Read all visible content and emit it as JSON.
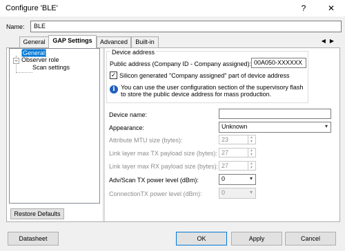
{
  "window": {
    "title": "Configure 'BLE'",
    "help_glyph": "?",
    "close_glyph": "✕"
  },
  "name_field": {
    "label": "Name:",
    "value": "BLE"
  },
  "tabs": [
    {
      "label": "General",
      "active": false
    },
    {
      "label": "GAP Settings",
      "active": true
    },
    {
      "label": "Advanced",
      "active": false
    },
    {
      "label": "Built-in",
      "active": false
    }
  ],
  "tab_scroll": {
    "left": "◀",
    "right": "▶"
  },
  "tree": {
    "items": [
      {
        "label": "General",
        "selected": true
      },
      {
        "label": "Observer role",
        "selected": false,
        "expander": "−"
      },
      {
        "label": "Scan settings",
        "selected": false
      }
    ],
    "restore_button": "Restore Defaults"
  },
  "device_address": {
    "group_title": "Device address",
    "public_label": "Public address (Company ID - Company assigned):",
    "public_value": "00A050-XXXXXX",
    "checkbox_label": "Silicon generated \"Company assigned\" part of device address",
    "checkbox_checked": true,
    "checkbox_glyph": "✓",
    "info_glyph": "i",
    "info_line1": "You can use the user configuration section of the supervisory flash",
    "info_line2": "to store the public device address for mass production."
  },
  "fields": {
    "device_name": {
      "label": "Device name:",
      "value": ""
    },
    "appearance": {
      "label": "Appearance:",
      "value": "Unknown"
    },
    "mtu": {
      "label": "Attribute MTU size (bytes):",
      "value": "23"
    },
    "tx_payload": {
      "label": "Link layer max TX payload size (bytes):",
      "value": "27"
    },
    "rx_payload": {
      "label": "Link layer max RX payload size (bytes):",
      "value": "27"
    },
    "adv_power": {
      "label": "Adv/Scan TX power level (dBm):",
      "value": "0"
    },
    "conn_power": {
      "label": "ConnectionTX power level (dBm):",
      "value": "0"
    }
  },
  "buttons": {
    "datasheet": "Datasheet",
    "ok": "OK",
    "apply": "Apply",
    "cancel": "Cancel"
  },
  "icons": {
    "dropdown": "▾",
    "spin_up": "▲",
    "spin_down": "▼"
  },
  "colors": {
    "selection": "#0078d7",
    "info_icon": "#1f5fbf"
  }
}
